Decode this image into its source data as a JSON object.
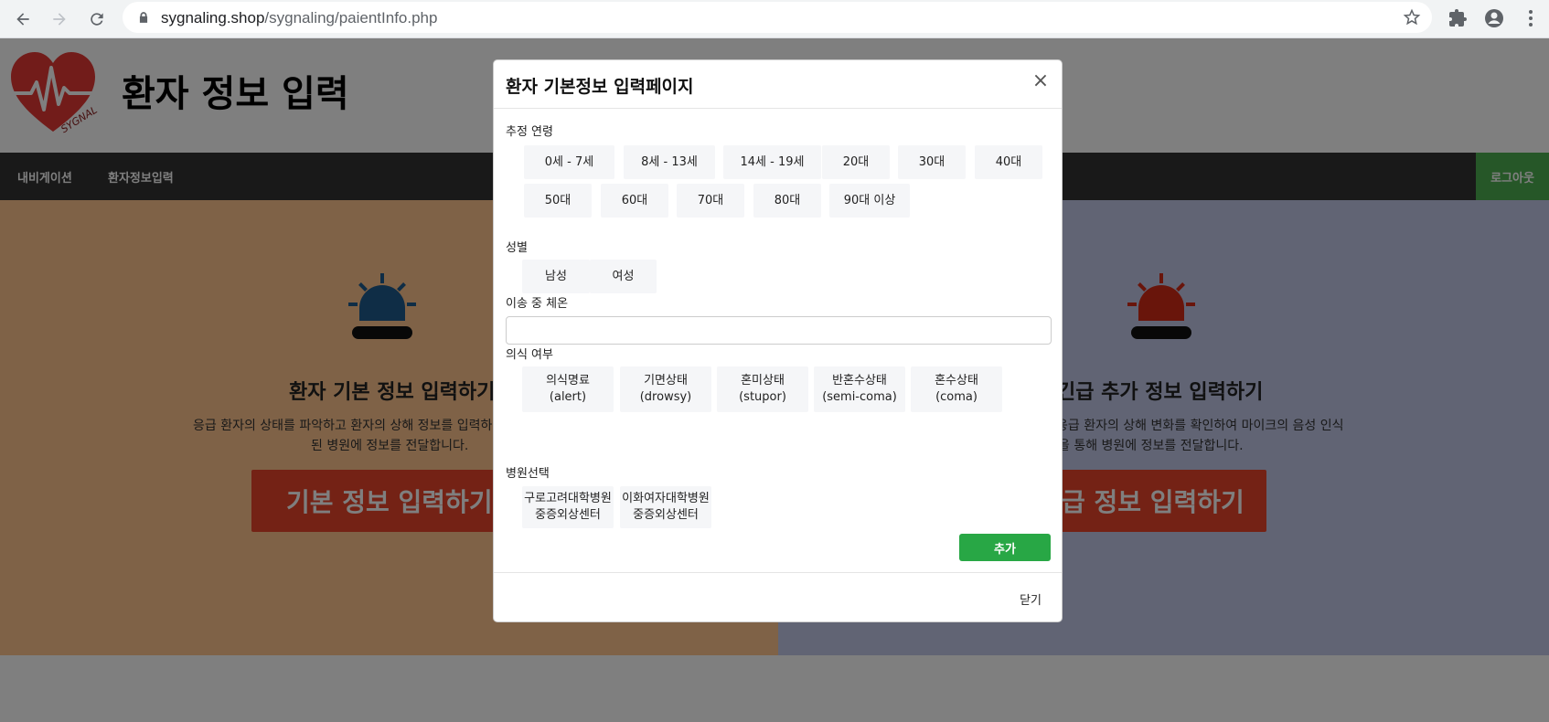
{
  "browser": {
    "url_host": "sygnaling.shop",
    "url_path": "/sygnaling/paientInfo.php"
  },
  "site": {
    "logo_text": "SYGNAL",
    "title": "환자 정보 입력",
    "nav": [
      "내비게이션",
      "환자정보입력"
    ],
    "logout": "로그아웃"
  },
  "panels": {
    "left": {
      "title": "환자 기본 정보 입력하기",
      "desc_line1": "응급 환자의 상태를 파악하고 환자의 상해 정보를 입력하",
      "desc_line2": "된 병원에 정보를 전달합니다.",
      "button": "기본 정보 입력하기",
      "accent": "#1e5a8c"
    },
    "right": {
      "title": "긴급 추가 정보 입력하기",
      "desc_line1": "응급 환자의 상해 변화를 확인하여 마이크의 음성 인식",
      "desc_line2": "을 통해 병원에 정보를 전달합니다.",
      "button": "긴급 정보 입력하기",
      "accent": "#d32b16"
    }
  },
  "modal": {
    "title": "환자 기본정보 입력페이지",
    "close_symbol": "×",
    "age_label": "추정 연령",
    "ages": [
      "0세 - 7세",
      "8세 - 13세",
      "14세 - 19세",
      "20대",
      "30대",
      "40대",
      "50대",
      "60대",
      "70대",
      "80대",
      "90대 이상"
    ],
    "sex_label": "성별",
    "sexes": [
      "남성",
      "여성"
    ],
    "temp_label": "이송 중 체온",
    "temp_value": "",
    "consciousness_label": "의식 여부",
    "consciousness": [
      {
        "ko": "의식명료",
        "en": "(alert)"
      },
      {
        "ko": "기면상태",
        "en": "(drowsy)"
      },
      {
        "ko": "혼미상태",
        "en": "(stupor)"
      },
      {
        "ko": "반혼수상태",
        "en": "(semi-coma)"
      },
      {
        "ko": "혼수상태",
        "en": "(coma)"
      }
    ],
    "hospital_label": "병원선택",
    "hospitals": [
      {
        "line1": "구로고려대학병원",
        "line2": "중증외상센터"
      },
      {
        "line1": "이화여자대학병원",
        "line2": "중증외상센터"
      }
    ],
    "add_button": "추가",
    "close_button": "닫기"
  },
  "colors": {
    "add_green": "#28a745",
    "navbar": "#333333",
    "logout_green": "#4caf50"
  }
}
